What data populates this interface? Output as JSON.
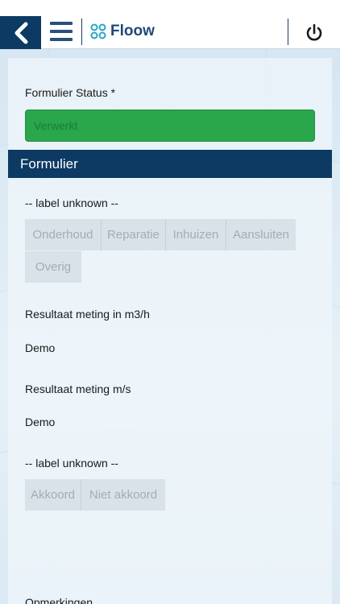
{
  "header": {
    "logo_text": "Floow"
  },
  "form": {
    "status_label": "Formulier Status *",
    "status_value": "Verwerkt",
    "status_color": "#2aa64b",
    "section_title": "Formulier",
    "label_unknown_1": "-- label unknown --",
    "options_1": [
      "Onderhoud",
      "Reparatie",
      "Inhuizen",
      "Aansluiten",
      "Overig"
    ],
    "result_m3h_label": "Resultaat meting in m3/h",
    "result_m3h_value": "Demo",
    "result_ms_label": "Resultaat meting m/s",
    "result_ms_value": "Demo",
    "label_unknown_2": "-- label unknown --",
    "options_2": [
      "Akkoord",
      "Niet akkoord"
    ],
    "opmerkingen_label": "Opmerkingen"
  },
  "colors": {
    "header_dark": "#0d3a63",
    "accent_green": "#2aa64b"
  }
}
